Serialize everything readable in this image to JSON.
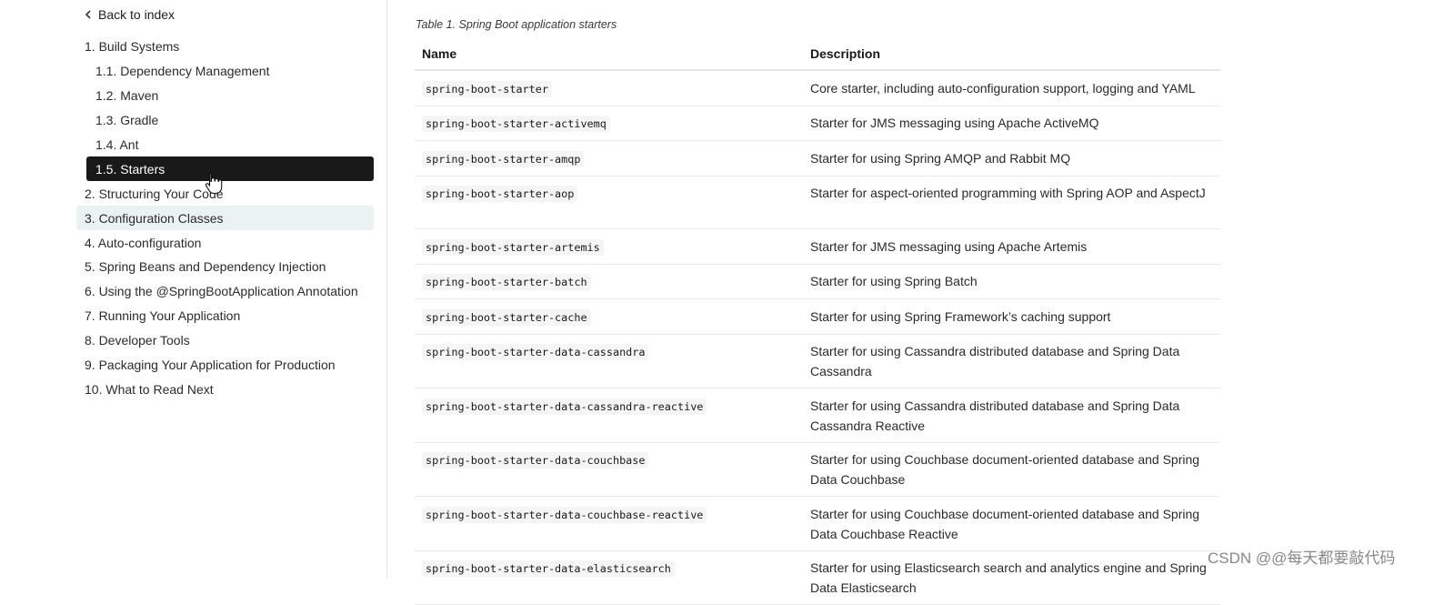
{
  "sidebar": {
    "back_label": "Back to index",
    "items": [
      {
        "label": "1. Build Systems",
        "level": 1,
        "state": "normal"
      },
      {
        "label": "1.1. Dependency Management",
        "level": 2,
        "state": "normal"
      },
      {
        "label": "1.2. Maven",
        "level": 2,
        "state": "normal"
      },
      {
        "label": "1.3. Gradle",
        "level": 2,
        "state": "normal"
      },
      {
        "label": "1.4. Ant",
        "level": 2,
        "state": "normal"
      },
      {
        "label": "1.5. Starters",
        "level": 2,
        "state": "active"
      },
      {
        "label": "2. Structuring Your Code",
        "level": 1,
        "state": "normal"
      },
      {
        "label": "3. Configuration Classes",
        "level": 1,
        "state": "hover"
      },
      {
        "label": "4. Auto-configuration",
        "level": 1,
        "state": "normal"
      },
      {
        "label": "5. Spring Beans and Dependency Injection",
        "level": 1,
        "state": "normal"
      },
      {
        "label": "6. Using the @SpringBootApplication Annotation",
        "level": 1,
        "state": "normal"
      },
      {
        "label": "7. Running Your Application",
        "level": 1,
        "state": "normal"
      },
      {
        "label": "8. Developer Tools",
        "level": 1,
        "state": "normal"
      },
      {
        "label": "9. Packaging Your Application for Production",
        "level": 1,
        "state": "normal"
      },
      {
        "label": "10. What to Read Next",
        "level": 1,
        "state": "normal"
      }
    ]
  },
  "table": {
    "caption": "Table 1. Spring Boot application starters",
    "headers": [
      "Name",
      "Description"
    ],
    "rows": [
      {
        "name": "spring-boot-starter",
        "description": "Core starter, including auto-configuration support, logging and YAML"
      },
      {
        "name": "spring-boot-starter-activemq",
        "description": "Starter for JMS messaging using Apache ActiveMQ"
      },
      {
        "name": "spring-boot-starter-amqp",
        "description": "Starter for using Spring AMQP and Rabbit MQ"
      },
      {
        "name": "spring-boot-starter-aop",
        "description": "Starter for aspect-oriented programming with Spring AOP and AspectJ"
      },
      {
        "name": "spring-boot-starter-artemis",
        "description": "Starter for JMS messaging using Apache Artemis"
      },
      {
        "name": "spring-boot-starter-batch",
        "description": "Starter for using Spring Batch"
      },
      {
        "name": "spring-boot-starter-cache",
        "description": "Starter for using Spring Framework’s caching support"
      },
      {
        "name": "spring-boot-starter-data-cassandra",
        "description": "Starter for using Cassandra distributed database and Spring Data Cassandra"
      },
      {
        "name": "spring-boot-starter-data-cassandra-reactive",
        "description": "Starter for using Cassandra distributed database and Spring Data Cassandra Reactive"
      },
      {
        "name": "spring-boot-starter-data-couchbase",
        "description": "Starter for using Couchbase document-oriented database and Spring Data Couchbase"
      },
      {
        "name": "spring-boot-starter-data-couchbase-reactive",
        "description": "Starter for using Couchbase document-oriented database and Spring Data Couchbase Reactive"
      },
      {
        "name": "spring-boot-starter-data-elasticsearch",
        "description": "Starter for using Elasticsearch search and analytics engine and Spring Data Elasticsearch"
      }
    ]
  },
  "watermark": "CSDN @@每天都要敲代码",
  "icons": {
    "back": "chevron-left-icon",
    "cursor": "hand-pointer-icon"
  },
  "colors": {
    "active_bg": "#191919",
    "hover_bg": "#ebf2f2",
    "code_bg": "#f5f5f5"
  }
}
